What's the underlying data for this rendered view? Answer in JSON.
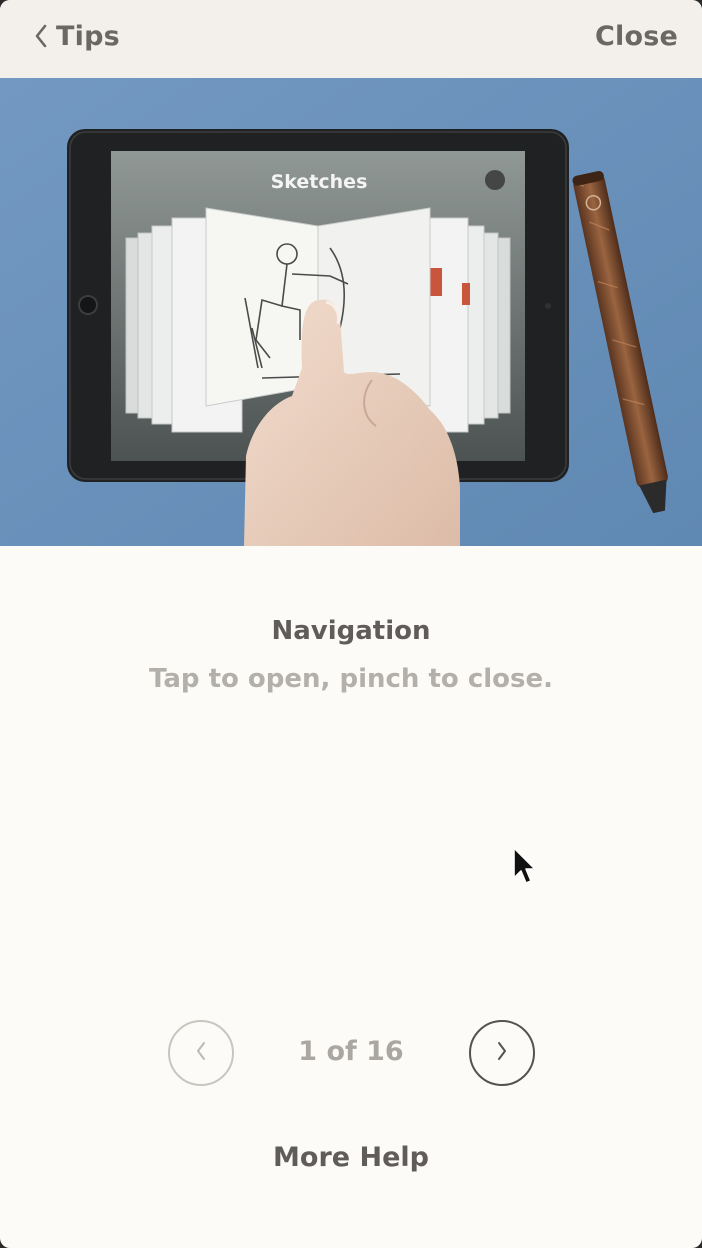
{
  "navbar": {
    "back_label": "Tips",
    "close_label": "Close"
  },
  "hero": {
    "screen_title": "Sketches"
  },
  "tip": {
    "title": "Navigation",
    "description": "Tap to open, pinch to close."
  },
  "pager": {
    "indicator": "1 of 16",
    "prev_icon": "chevron-left-icon",
    "next_icon": "chevron-right-icon"
  },
  "footer": {
    "more_help_label": "More Help"
  },
  "colors": {
    "navbar_bg": "#f3efea",
    "content_bg": "#fcfbf8",
    "hero_bg": "#6a93bd",
    "title_text": "#5f5c5a",
    "muted_text": "#b3afab"
  }
}
